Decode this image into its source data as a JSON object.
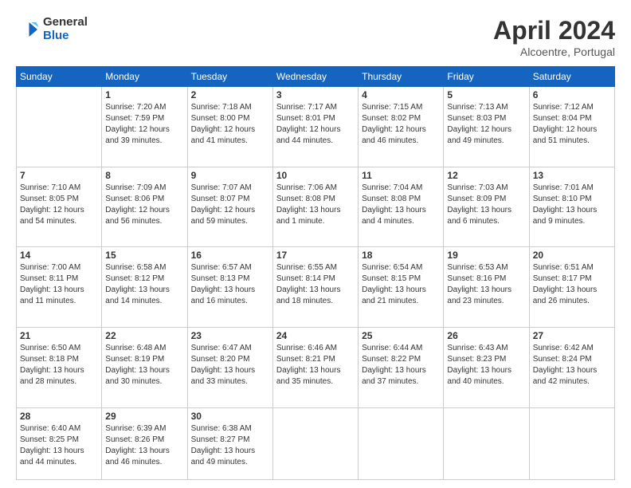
{
  "header": {
    "logo_general": "General",
    "logo_blue": "Blue",
    "month_title": "April 2024",
    "location": "Alcoentre, Portugal"
  },
  "days_of_week": [
    "Sunday",
    "Monday",
    "Tuesday",
    "Wednesday",
    "Thursday",
    "Friday",
    "Saturday"
  ],
  "weeks": [
    [
      {
        "day": "",
        "info": ""
      },
      {
        "day": "1",
        "info": "Sunrise: 7:20 AM\nSunset: 7:59 PM\nDaylight: 12 hours\nand 39 minutes."
      },
      {
        "day": "2",
        "info": "Sunrise: 7:18 AM\nSunset: 8:00 PM\nDaylight: 12 hours\nand 41 minutes."
      },
      {
        "day": "3",
        "info": "Sunrise: 7:17 AM\nSunset: 8:01 PM\nDaylight: 12 hours\nand 44 minutes."
      },
      {
        "day": "4",
        "info": "Sunrise: 7:15 AM\nSunset: 8:02 PM\nDaylight: 12 hours\nand 46 minutes."
      },
      {
        "day": "5",
        "info": "Sunrise: 7:13 AM\nSunset: 8:03 PM\nDaylight: 12 hours\nand 49 minutes."
      },
      {
        "day": "6",
        "info": "Sunrise: 7:12 AM\nSunset: 8:04 PM\nDaylight: 12 hours\nand 51 minutes."
      }
    ],
    [
      {
        "day": "7",
        "info": "Sunrise: 7:10 AM\nSunset: 8:05 PM\nDaylight: 12 hours\nand 54 minutes."
      },
      {
        "day": "8",
        "info": "Sunrise: 7:09 AM\nSunset: 8:06 PM\nDaylight: 12 hours\nand 56 minutes."
      },
      {
        "day": "9",
        "info": "Sunrise: 7:07 AM\nSunset: 8:07 PM\nDaylight: 12 hours\nand 59 minutes."
      },
      {
        "day": "10",
        "info": "Sunrise: 7:06 AM\nSunset: 8:08 PM\nDaylight: 13 hours\nand 1 minute."
      },
      {
        "day": "11",
        "info": "Sunrise: 7:04 AM\nSunset: 8:08 PM\nDaylight: 13 hours\nand 4 minutes."
      },
      {
        "day": "12",
        "info": "Sunrise: 7:03 AM\nSunset: 8:09 PM\nDaylight: 13 hours\nand 6 minutes."
      },
      {
        "day": "13",
        "info": "Sunrise: 7:01 AM\nSunset: 8:10 PM\nDaylight: 13 hours\nand 9 minutes."
      }
    ],
    [
      {
        "day": "14",
        "info": "Sunrise: 7:00 AM\nSunset: 8:11 PM\nDaylight: 13 hours\nand 11 minutes."
      },
      {
        "day": "15",
        "info": "Sunrise: 6:58 AM\nSunset: 8:12 PM\nDaylight: 13 hours\nand 14 minutes."
      },
      {
        "day": "16",
        "info": "Sunrise: 6:57 AM\nSunset: 8:13 PM\nDaylight: 13 hours\nand 16 minutes."
      },
      {
        "day": "17",
        "info": "Sunrise: 6:55 AM\nSunset: 8:14 PM\nDaylight: 13 hours\nand 18 minutes."
      },
      {
        "day": "18",
        "info": "Sunrise: 6:54 AM\nSunset: 8:15 PM\nDaylight: 13 hours\nand 21 minutes."
      },
      {
        "day": "19",
        "info": "Sunrise: 6:53 AM\nSunset: 8:16 PM\nDaylight: 13 hours\nand 23 minutes."
      },
      {
        "day": "20",
        "info": "Sunrise: 6:51 AM\nSunset: 8:17 PM\nDaylight: 13 hours\nand 26 minutes."
      }
    ],
    [
      {
        "day": "21",
        "info": "Sunrise: 6:50 AM\nSunset: 8:18 PM\nDaylight: 13 hours\nand 28 minutes."
      },
      {
        "day": "22",
        "info": "Sunrise: 6:48 AM\nSunset: 8:19 PM\nDaylight: 13 hours\nand 30 minutes."
      },
      {
        "day": "23",
        "info": "Sunrise: 6:47 AM\nSunset: 8:20 PM\nDaylight: 13 hours\nand 33 minutes."
      },
      {
        "day": "24",
        "info": "Sunrise: 6:46 AM\nSunset: 8:21 PM\nDaylight: 13 hours\nand 35 minutes."
      },
      {
        "day": "25",
        "info": "Sunrise: 6:44 AM\nSunset: 8:22 PM\nDaylight: 13 hours\nand 37 minutes."
      },
      {
        "day": "26",
        "info": "Sunrise: 6:43 AM\nSunset: 8:23 PM\nDaylight: 13 hours\nand 40 minutes."
      },
      {
        "day": "27",
        "info": "Sunrise: 6:42 AM\nSunset: 8:24 PM\nDaylight: 13 hours\nand 42 minutes."
      }
    ],
    [
      {
        "day": "28",
        "info": "Sunrise: 6:40 AM\nSunset: 8:25 PM\nDaylight: 13 hours\nand 44 minutes."
      },
      {
        "day": "29",
        "info": "Sunrise: 6:39 AM\nSunset: 8:26 PM\nDaylight: 13 hours\nand 46 minutes."
      },
      {
        "day": "30",
        "info": "Sunrise: 6:38 AM\nSunset: 8:27 PM\nDaylight: 13 hours\nand 49 minutes."
      },
      {
        "day": "",
        "info": ""
      },
      {
        "day": "",
        "info": ""
      },
      {
        "day": "",
        "info": ""
      },
      {
        "day": "",
        "info": ""
      }
    ]
  ]
}
